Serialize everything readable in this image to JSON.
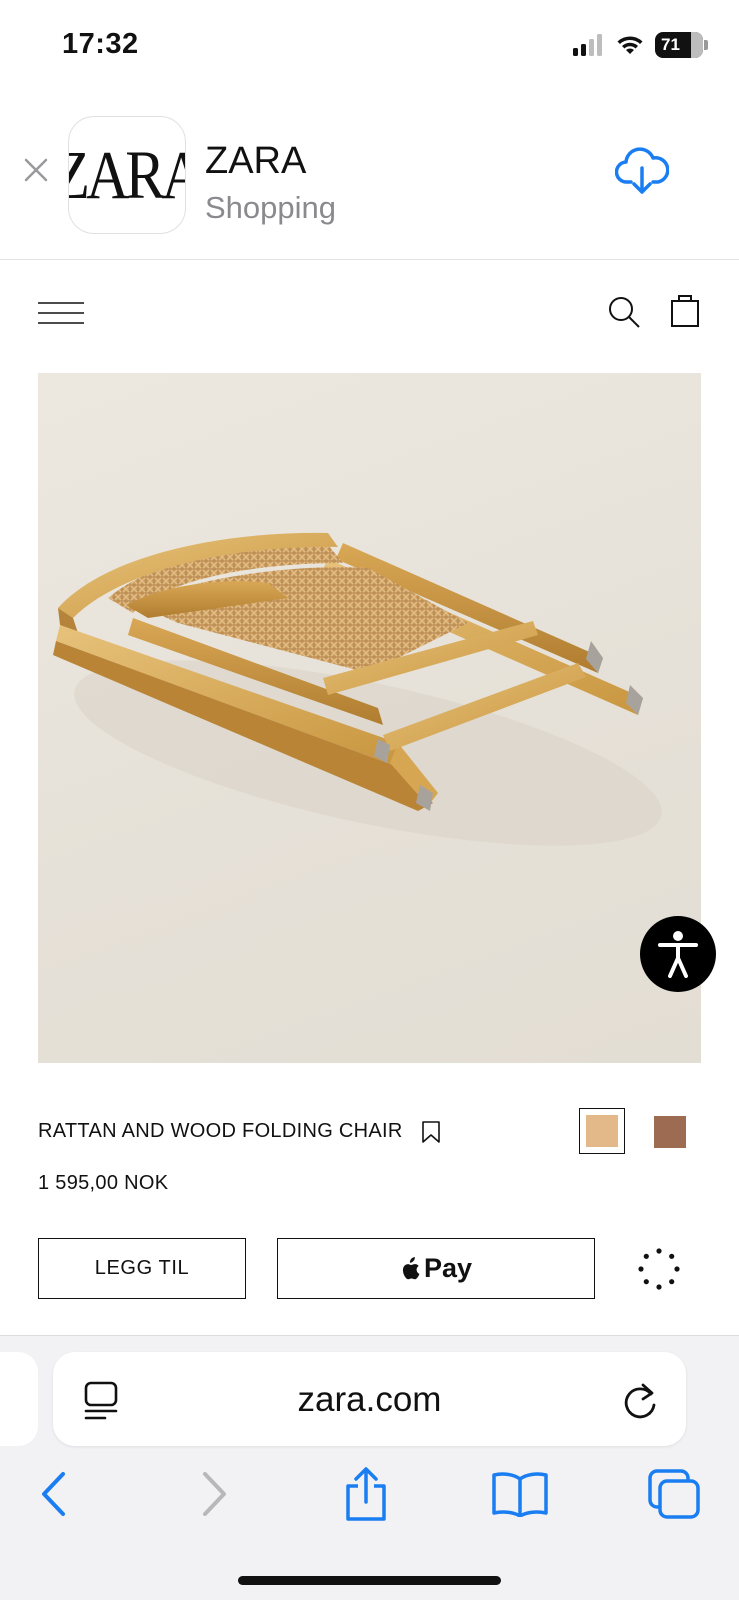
{
  "status": {
    "time": "17:32",
    "battery": "71"
  },
  "banner": {
    "app_icon_text": "ZARA",
    "app_name": "ZARA",
    "app_category": "Shopping"
  },
  "product": {
    "name": "RATTAN AND WOOD FOLDING CHAIR",
    "price": "1 595,00 NOK",
    "colors": [
      "#e3b98a",
      "#9c6b51"
    ],
    "add_button": "LEGG TIL",
    "applepay_label": "Pay"
  },
  "browser": {
    "url": "zara.com"
  },
  "icons": {
    "close": "close-icon",
    "download": "cloud-download-icon",
    "menu": "menu-icon",
    "search": "search-icon",
    "bag": "shopping-bag-icon",
    "bookmark": "bookmark-icon",
    "accessibility": "accessibility-icon",
    "reader": "reader-icon",
    "reload": "reload-icon",
    "back": "back-icon",
    "forward": "forward-icon",
    "share": "share-icon",
    "bookmarks": "bookmarks-icon",
    "tabs": "tabs-icon"
  },
  "accent": "#1a7ef2"
}
